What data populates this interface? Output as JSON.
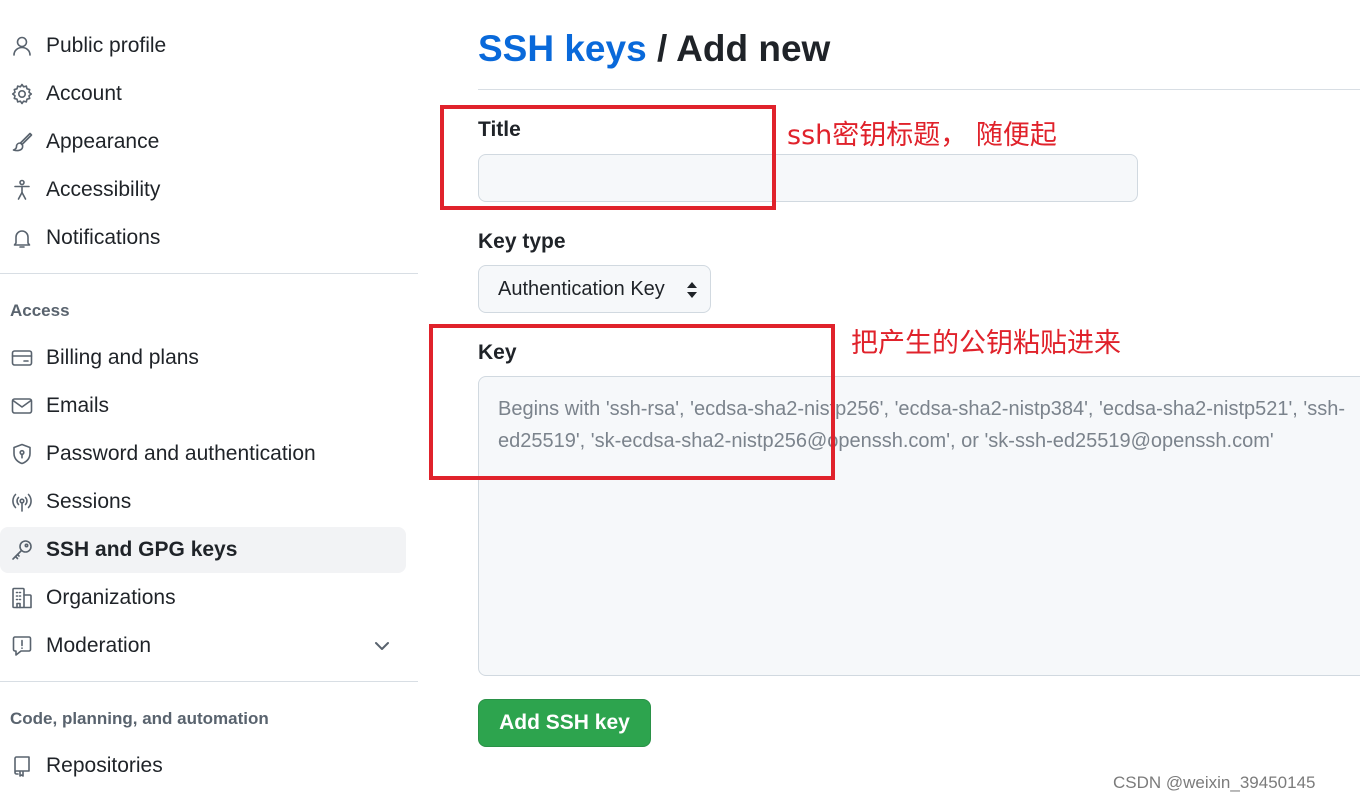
{
  "sidebar": {
    "items_top": [
      {
        "label": "Public profile",
        "icon": "person-icon"
      },
      {
        "label": "Account",
        "icon": "gear-icon"
      },
      {
        "label": "Appearance",
        "icon": "paintbrush-icon"
      },
      {
        "label": "Accessibility",
        "icon": "accessibility-icon"
      },
      {
        "label": "Notifications",
        "icon": "bell-icon"
      }
    ],
    "access_heading": "Access",
    "items_access": [
      {
        "label": "Billing and plans",
        "icon": "credit-card-icon"
      },
      {
        "label": "Emails",
        "icon": "mail-icon"
      },
      {
        "label": "Password and authentication",
        "icon": "shield-lock-icon"
      },
      {
        "label": "Sessions",
        "icon": "broadcast-icon"
      },
      {
        "label": "SSH and GPG keys",
        "icon": "key-icon",
        "active": true
      },
      {
        "label": "Organizations",
        "icon": "organization-icon"
      },
      {
        "label": "Moderation",
        "icon": "report-icon",
        "expandable": true
      }
    ],
    "code_heading": "Code, planning, and automation",
    "items_code": [
      {
        "label": "Repositories",
        "icon": "repo-icon"
      }
    ]
  },
  "main": {
    "breadcrumb_link": "SSH keys",
    "breadcrumb_sep": " / ",
    "breadcrumb_current": "Add new",
    "title_label": "Title",
    "title_value": "",
    "key_type_label": "Key type",
    "key_type_value": "Authentication Key",
    "key_label": "Key",
    "key_placeholder": "Begins with 'ssh-rsa', 'ecdsa-sha2-nistp256', 'ecdsa-sha2-nistp384', 'ecdsa-sha2-nistp521', 'ssh-ed25519', 'sk-ecdsa-sha2-nistp256@openssh.com', or 'sk-ssh-ed25519@openssh.com'",
    "submit_label": "Add SSH key"
  },
  "annotations": {
    "title_note": "ssh密钥标题， 随便起",
    "key_note": "把产生的公钥粘贴进来",
    "color": "#e0222b"
  },
  "watermark": "CSDN @weixin_39450145",
  "colors": {
    "link": "#0969da",
    "primary_button": "#2da44e",
    "active_nav_bg": "#f2f3f5"
  }
}
